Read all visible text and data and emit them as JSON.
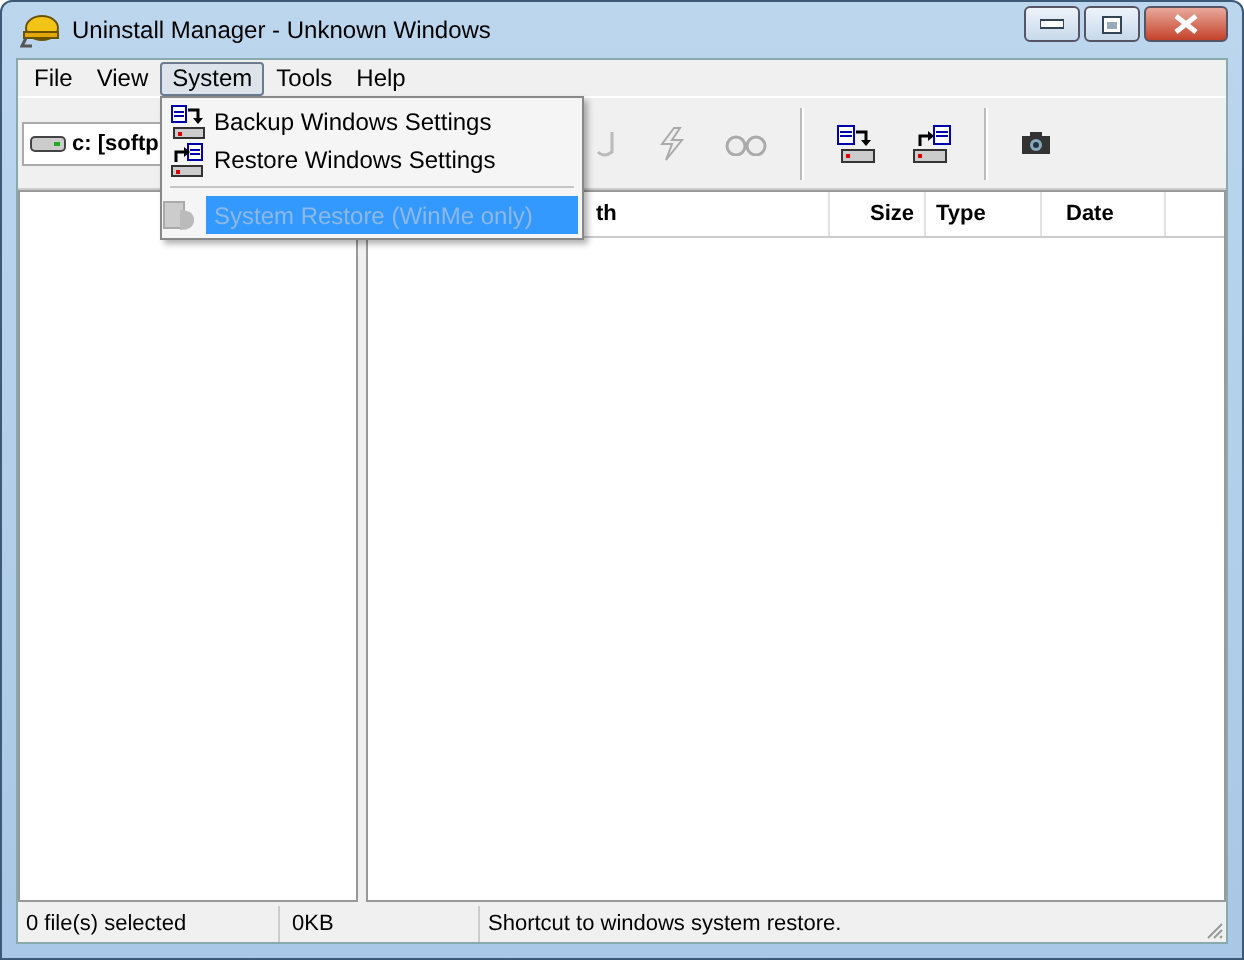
{
  "window": {
    "title": "Uninstall Manager - Unknown Windows"
  },
  "menu": [
    {
      "label": "File",
      "selected": false
    },
    {
      "label": "View",
      "selected": false
    },
    {
      "label": "System",
      "selected": true
    },
    {
      "label": "Tools",
      "selected": false
    },
    {
      "label": "Help",
      "selected": false
    }
  ],
  "dropdown": [
    {
      "kind": "item",
      "label": "Backup Windows Settings",
      "disabled": false,
      "selected": false
    },
    {
      "kind": "item",
      "label": "Restore Windows Settings",
      "disabled": false,
      "selected": false
    },
    {
      "kind": "separator"
    },
    {
      "kind": "item",
      "label": "System Restore (WinMe only)",
      "disabled": true,
      "selected": true
    }
  ],
  "drive": {
    "label": "c: [softp"
  },
  "columns": [
    {
      "label": "th"
    },
    {
      "label": "Size"
    },
    {
      "label": "Type"
    },
    {
      "label": "Date"
    }
  ],
  "status_bar": [
    "0 file(s) selected",
    "0KB",
    "Shortcut to windows system restore."
  ]
}
